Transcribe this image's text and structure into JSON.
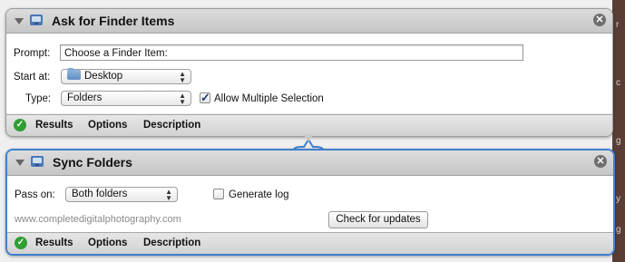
{
  "action1": {
    "title": "Ask for Finder Items",
    "close_glyph": "✕",
    "prompt_label": "Prompt:",
    "prompt_value": "Choose a Finder Item:",
    "start_label": "Start at:",
    "start_value": "Desktop",
    "type_label": "Type:",
    "type_value": "Folders",
    "allow_multiple_label": "Allow Multiple Selection",
    "allow_multiple_checked": true,
    "footer": {
      "results": "Results",
      "options": "Options",
      "description": "Description"
    }
  },
  "action2": {
    "title": "Sync Folders",
    "close_glyph": "✕",
    "pass_on_label": "Pass on:",
    "pass_on_value": "Both folders",
    "generate_log_label": "Generate log",
    "generate_log_checked": false,
    "website": "www.completedigitalphotography.com",
    "check_updates": "Check for updates",
    "footer": {
      "results": "Results",
      "options": "Options",
      "description": "Description"
    }
  },
  "icons": {
    "collapse": "disclosure-triangle-icon",
    "app": "automator-icon",
    "close": "close-icon",
    "folder": "folder-icon",
    "status": "checkmark-status-icon"
  },
  "colors": {
    "selected_border": "#3f7fd0",
    "status_green": "#2f9e33",
    "checkbox_mark": "#1a3c7a"
  }
}
